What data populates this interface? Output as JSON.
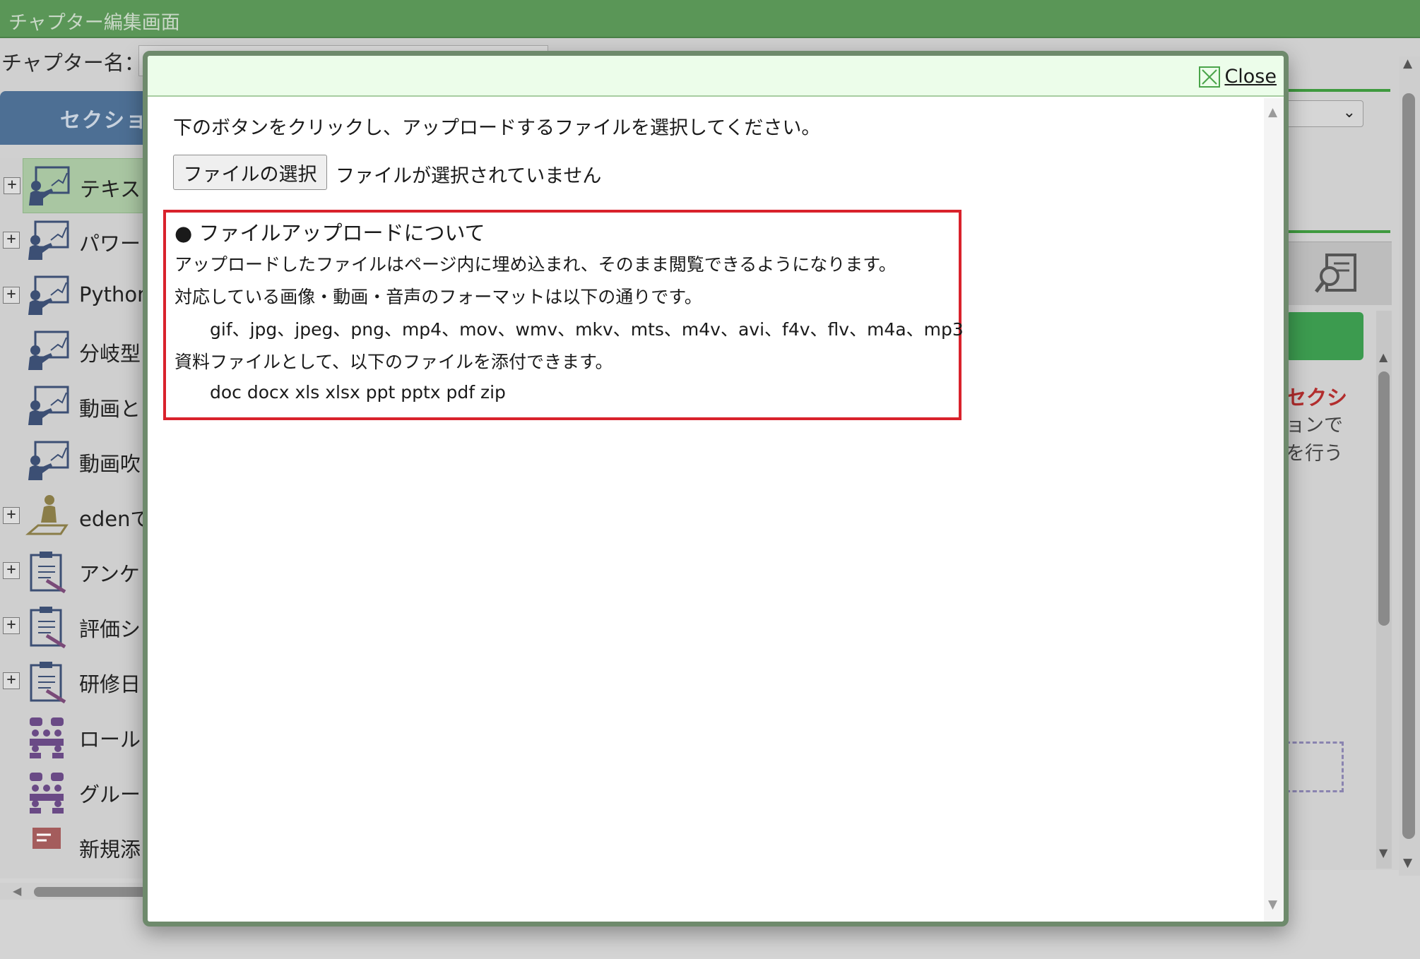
{
  "window": {
    "title": "チャプター編集画面"
  },
  "chapter": {
    "name_label": "チャプター名：",
    "name_value": ""
  },
  "section_tab": {
    "label": "セクショ"
  },
  "tree": {
    "items": [
      {
        "label": "テキス",
        "icon": "teacher-board-icon",
        "expandable": true,
        "selected": true
      },
      {
        "label": "パワー",
        "icon": "teacher-board-icon",
        "expandable": true,
        "selected": false
      },
      {
        "label": "Python",
        "icon": "teacher-board-icon",
        "expandable": true,
        "selected": false
      },
      {
        "label": "分岐型",
        "icon": "teacher-board-icon",
        "expandable": false,
        "selected": false
      },
      {
        "label": "動画と",
        "icon": "teacher-board-icon",
        "expandable": false,
        "selected": false
      },
      {
        "label": "動画吹",
        "icon": "teacher-board-icon",
        "expandable": false,
        "selected": false
      },
      {
        "label": "edenで",
        "icon": "person-seated-icon",
        "expandable": true,
        "selected": false
      },
      {
        "label": "アンケ",
        "icon": "clipboard-icon",
        "expandable": true,
        "selected": false
      },
      {
        "label": "評価シ",
        "icon": "clipboard-icon",
        "expandable": true,
        "selected": false
      },
      {
        "label": "研修日",
        "icon": "clipboard-icon",
        "expandable": true,
        "selected": false
      },
      {
        "label": "ロール",
        "icon": "group-chat-icon",
        "expandable": false,
        "selected": false
      },
      {
        "label": "グルー",
        "icon": "group-chat-icon",
        "expandable": false,
        "selected": false
      },
      {
        "label": "新規添",
        "icon": "attachment-icon",
        "expandable": false,
        "selected": false
      }
    ]
  },
  "right_pane": {
    "select_arrow": "⌄",
    "red_text": "セクシ",
    "text1": "ョンで",
    "text2": "を行う",
    "accent_color": "#3c9b4f"
  },
  "modal": {
    "close_label": "Close",
    "instruction": "下のボタンをクリックし、アップロードするファイルを選択してください。",
    "file_button_label": "ファイルの選択",
    "file_status": "ファイルが選択されていません",
    "info": {
      "heading": "● ファイルアップロードについて",
      "line1": "アップロードしたファイルはページ内に埋め込まれ、そのまま閲覧できるようになります。",
      "line2": "対応している画像・動画・音声のフォーマットは以下の通りです。",
      "media_formats": "gif、jpg、jpeg、png、mp4、mov、wmv、mkv、mts、m4v、avi、f4v、flv、m4a、mp3",
      "line3": "資料ファイルとして、以下のファイルを添付できます。",
      "doc_formats": "doc docx xls xlsx ppt pptx pdf zip"
    },
    "border_color": "#d9222c"
  }
}
